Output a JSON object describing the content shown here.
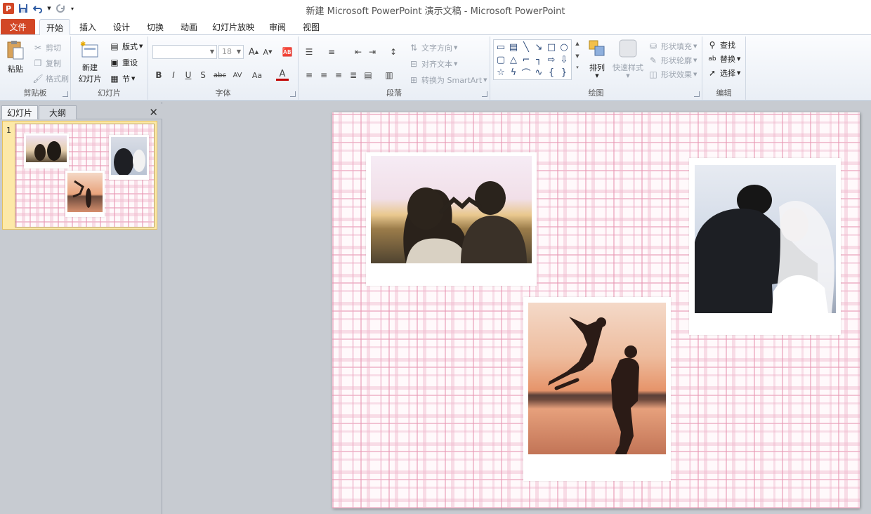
{
  "app": {
    "title": "新建 Microsoft PowerPoint 演示文稿 - Microsoft PowerPoint",
    "logo_letter": "P"
  },
  "quick_access": {
    "customize_icon": "customize-icon",
    "items": [
      "save-icon",
      "undo-icon",
      "redo-icon"
    ]
  },
  "tabs": {
    "file": "文件",
    "items": [
      "开始",
      "插入",
      "设计",
      "切换",
      "动画",
      "幻灯片放映",
      "审阅",
      "视图"
    ],
    "active": "开始"
  },
  "ribbon": {
    "clipboard": {
      "label": "剪贴板",
      "paste": "粘贴",
      "cut": "剪切",
      "copy": "复制",
      "format_painter": "格式刷"
    },
    "slides": {
      "label": "幻灯片",
      "new_slide": "新建",
      "new_slide_line2": "幻灯片",
      "layout": "版式",
      "reset": "重设",
      "section": "节"
    },
    "font": {
      "label": "字体",
      "font_name": "",
      "font_size": "18",
      "grow": "A",
      "shrink": "A",
      "bold": "B",
      "italic": "I",
      "underline": "U",
      "shadow": "S",
      "strike": "abc",
      "spacing": "AV",
      "case": "Aa",
      "color": "A"
    },
    "paragraph": {
      "label": "段落",
      "text_direction": "文字方向",
      "align_text": "对齐文本",
      "smartart": "转换为 SmartArt"
    },
    "drawing": {
      "label": "绘图",
      "arrange": "排列",
      "quick_styles": "快速样式",
      "shape_fill": "形状填充",
      "shape_outline": "形状轮廓",
      "shape_effects": "形状效果"
    },
    "editing": {
      "label": "编辑",
      "find": "查找",
      "replace": "替换",
      "select": "选择"
    }
  },
  "left_pane": {
    "tab_slides": "幻灯片",
    "tab_outline": "大纲",
    "slide_number": "1"
  },
  "colors": {
    "file_tab": "#d24625",
    "plaid_pink": "#e896b2",
    "thumb_highlight": "#fde9a8"
  }
}
